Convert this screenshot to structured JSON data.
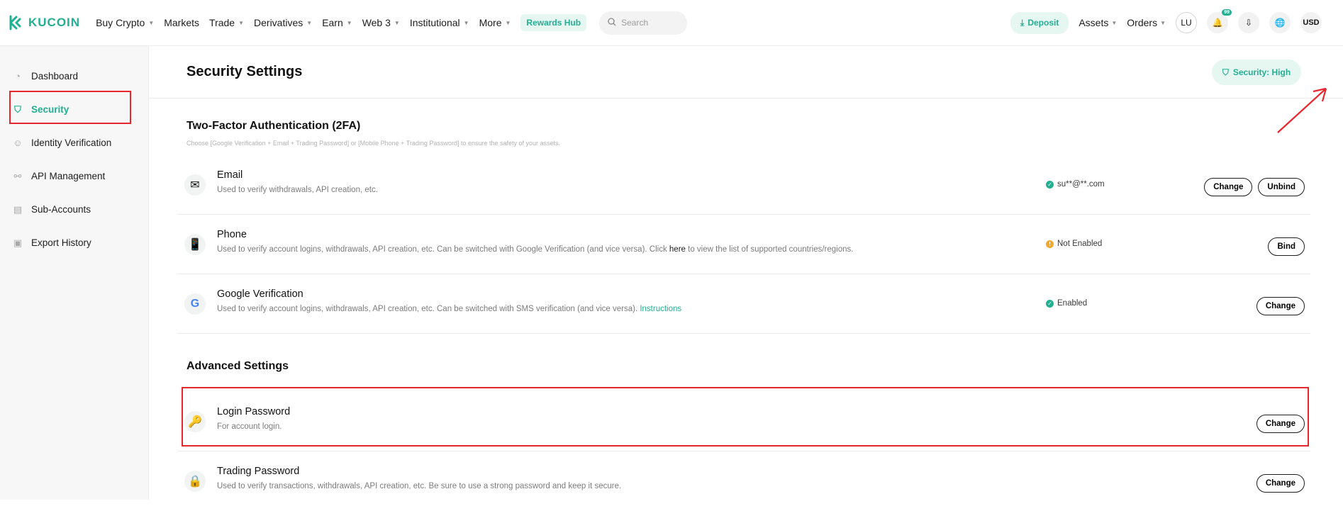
{
  "header": {
    "logo": "KUCOIN",
    "nav": [
      {
        "label": "Buy Crypto",
        "caret": true
      },
      {
        "label": "Markets",
        "caret": false
      },
      {
        "label": "Trade",
        "caret": true
      },
      {
        "label": "Derivatives",
        "caret": true
      },
      {
        "label": "Earn",
        "caret": true
      },
      {
        "label": "Web 3",
        "caret": true
      },
      {
        "label": "Institutional",
        "caret": true
      },
      {
        "label": "More",
        "caret": true
      }
    ],
    "rewards": "Rewards Hub",
    "search_placeholder": "Search",
    "deposit": "Deposit",
    "assets": "Assets",
    "orders": "Orders",
    "avatar": "LU",
    "notif_count": "99",
    "currency": "USD"
  },
  "sidebar": {
    "items": [
      {
        "label": "Dashboard",
        "icon": "pie-chart-icon"
      },
      {
        "label": "Security",
        "icon": "shield-check-icon",
        "active": true
      },
      {
        "label": "Identity Verification",
        "icon": "user-id-icon"
      },
      {
        "label": "API Management",
        "icon": "link-icon"
      },
      {
        "label": "Sub-Accounts",
        "icon": "sub-accounts-icon"
      },
      {
        "label": "Export History",
        "icon": "clipboard-icon"
      }
    ]
  },
  "main": {
    "title": "Security Settings",
    "security_level": "Security: High",
    "twofa": {
      "heading": "Two-Factor Authentication (2FA)",
      "description": "Choose [Google Verification + Email + Trading Password] or [Mobile Phone + Trading Password] to ensure the safety of your assets."
    },
    "rows": [
      {
        "name": "Email",
        "desc": "Used to verify withdrawals, API creation, etc.",
        "status": "su**@**.com",
        "status_type": "ok",
        "buttons": [
          "Change",
          "Unbind"
        ]
      },
      {
        "name": "Phone",
        "desc_pre": "Used to verify account logins, withdrawals, API creation, etc. Can be switched with Google Verification (and vice versa). Click ",
        "desc_link": "here",
        "desc_post": " to view the list of supported countries/regions.",
        "status": "Not Enabled",
        "status_type": "warn",
        "buttons": [
          "Bind"
        ]
      },
      {
        "name": "Google Verification",
        "desc_pre": "Used to verify account logins, withdrawals, API creation, etc. Can be switched with SMS verification (and vice versa). ",
        "desc_link": "Instructions",
        "status": "Enabled",
        "status_type": "ok",
        "buttons": [
          "Change"
        ]
      }
    ],
    "advanced": {
      "heading": "Advanced Settings",
      "rows": [
        {
          "name": "Login Password",
          "desc": "For account login.",
          "buttons": [
            "Change"
          ]
        },
        {
          "name": "Trading Password",
          "desc": "Used to verify transactions, withdrawals, API creation, etc. Be sure to use a strong password and keep it secure.",
          "buttons": [
            "Change"
          ]
        }
      ]
    }
  },
  "colors": {
    "accent": "#23af91",
    "highlight": "#e8262e"
  }
}
